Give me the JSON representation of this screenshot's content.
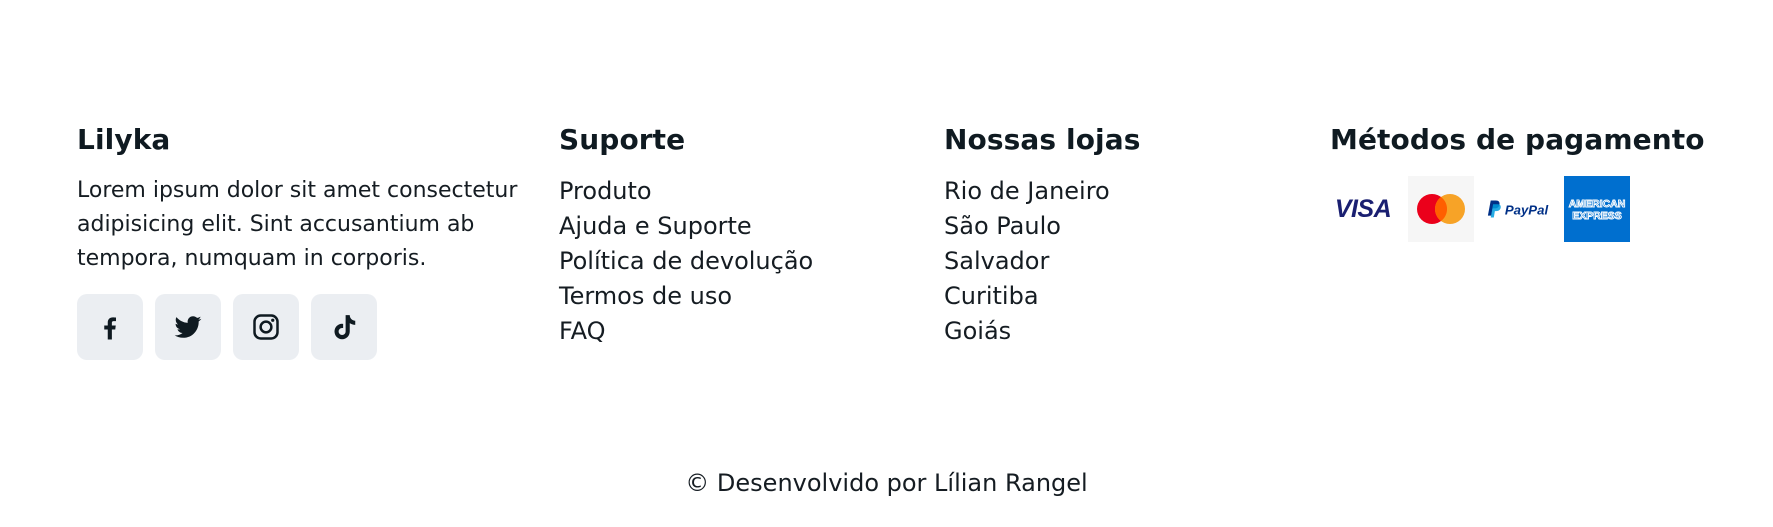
{
  "brand": {
    "title": "Lilyka",
    "description": "Lorem ipsum dolor sit amet consectetur adipisicing elit. Sint accusantium ab tempora, numquam in corporis.",
    "social": [
      {
        "name": "facebook-icon"
      },
      {
        "name": "twitter-icon"
      },
      {
        "name": "instagram-icon"
      },
      {
        "name": "tiktok-icon"
      }
    ]
  },
  "support": {
    "title": "Suporte",
    "links": [
      "Produto",
      "Ajuda e Suporte",
      "Política de devolução",
      "Termos de uso",
      "FAQ"
    ]
  },
  "stores": {
    "title": "Nossas lojas",
    "links": [
      "Rio de Janeiro",
      "São Paulo",
      "Salvador",
      "Curitiba",
      "Goiás"
    ]
  },
  "payment": {
    "title": "Métodos de pagamento",
    "methods": [
      {
        "icon": "visa-logo",
        "label": "VISA"
      },
      {
        "icon": "mastercard-logo"
      },
      {
        "icon": "paypal-logo",
        "label": "PayPal"
      },
      {
        "icon": "amex-logo",
        "label_line1": "AMERICAN",
        "label_line2": "EXPRESS"
      }
    ]
  },
  "footer": {
    "copyright": "© Desenvolvido por Lílian Rangel"
  },
  "colors": {
    "text": "#151c22",
    "social_bg": "#ebeef2",
    "visa_blue": "#1a1f71",
    "mastercard_red": "#eb001b",
    "mastercard_orange": "#f79e1b",
    "paypal_dark": "#003087",
    "paypal_light": "#009cde",
    "amex_blue": "#006fcf"
  }
}
